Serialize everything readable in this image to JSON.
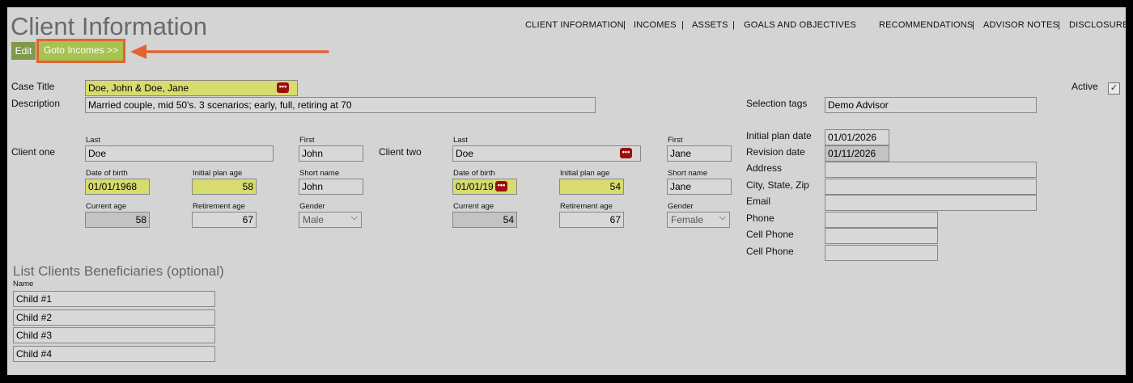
{
  "page_title": "Client Information",
  "nav": [
    "CLIENT INFORMATION",
    "INCOMES",
    "ASSETS",
    "GOALS AND OBJECTIVES",
    "RECOMMENDATIONS",
    "ADVISOR NOTES",
    "DISCLOSURE"
  ],
  "nav_sep": "|",
  "buttons": {
    "edit": "Edit",
    "goto": "Goto Incomes >>"
  },
  "highlight_color": "#e06334",
  "case_title": {
    "label": "Case Title",
    "value": "Doe, John & Doe, Jane"
  },
  "description": {
    "label": "Description",
    "value": "Married couple, mid 50's. 3 scenarios; early, full, retiring at 70"
  },
  "active_label": "Active",
  "active_checked": true,
  "selection_tags": {
    "label": "Selection tags",
    "value": "Demo Advisor"
  },
  "client_one": {
    "label": "Client one",
    "last_label": "Last",
    "last": "Doe",
    "first_label": "First",
    "first": "John",
    "dob_label": "Date of birth",
    "dob": "01/01/1968",
    "plan_age_label": "Initial plan age",
    "plan_age": "58",
    "short_label": "Short name",
    "short": "John",
    "cur_age_label": "Current age",
    "cur_age": "58",
    "ret_age_label": "Retirement age",
    "ret_age": "67",
    "gender_label": "Gender",
    "gender": "Male"
  },
  "client_two": {
    "label": "Client two",
    "last_label": "Last",
    "last": "Doe",
    "first_label": "First",
    "first": "Jane",
    "dob_label": "Date of birth",
    "dob": "01/01/19",
    "plan_age_label": "Initial plan age",
    "plan_age": "54",
    "short_label": "Short name",
    "short": "Jane",
    "cur_age_label": "Current age",
    "cur_age": "54",
    "ret_age_label": "Retirement age",
    "ret_age": "67",
    "gender_label": "Gender",
    "gender": "Female"
  },
  "right_fields": {
    "initial_plan_date_label": "Initial plan date",
    "initial_plan_date": "01/01/2026",
    "revision_date_label": "Revision date",
    "revision_date": "01/11/2026",
    "address_label": "Address",
    "address": "",
    "city_label": "City, State, Zip",
    "city": "",
    "email_label": "Email",
    "email": "",
    "phone_label": "Phone",
    "phone": "",
    "cell1_label": "Cell Phone",
    "cell1": "",
    "cell2_label": "Cell Phone",
    "cell2": ""
  },
  "beneficiaries": {
    "title": "List Clients Beneficiaries (optional)",
    "name_label": "Name",
    "items": [
      "Child #1",
      "Child #2",
      "Child #3",
      "Child #4"
    ]
  },
  "dots_glyph": "•••",
  "chevron_glyph": "⌵",
  "check_glyph": "✓"
}
